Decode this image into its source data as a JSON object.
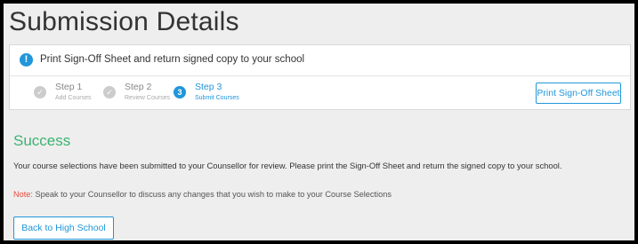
{
  "page": {
    "title": "Submission Details"
  },
  "notice": {
    "icon": "info-icon",
    "icon_glyph": "!",
    "text": "Print Sign-Off Sheet and return signed copy to your school"
  },
  "steps": [
    {
      "name": "Step 1",
      "sub": "Add Courses",
      "status": "complete",
      "glyph": "✓"
    },
    {
      "name": "Step 2",
      "sub": "Review Courses",
      "status": "complete",
      "glyph": "✓"
    },
    {
      "name": "Step 3",
      "sub": "Submit Courses",
      "status": "current",
      "glyph": "3"
    }
  ],
  "actions": {
    "print_label": "Print Sign-Off Sheet",
    "back_label": "Back to High School"
  },
  "result": {
    "title": "Success",
    "message": "Your course selections have been submitted to your Counsellor for review. Please print the Sign-Off Sheet and return the signed copy to your school.",
    "note_label": "Note:",
    "note_text": "Speak to your Counsellor to discuss any changes that you wish to make to your Course Selections"
  },
  "colors": {
    "accent": "#2196d9",
    "success": "#3cb371",
    "note": "#e74c3c",
    "step_complete": "#cccccc"
  }
}
